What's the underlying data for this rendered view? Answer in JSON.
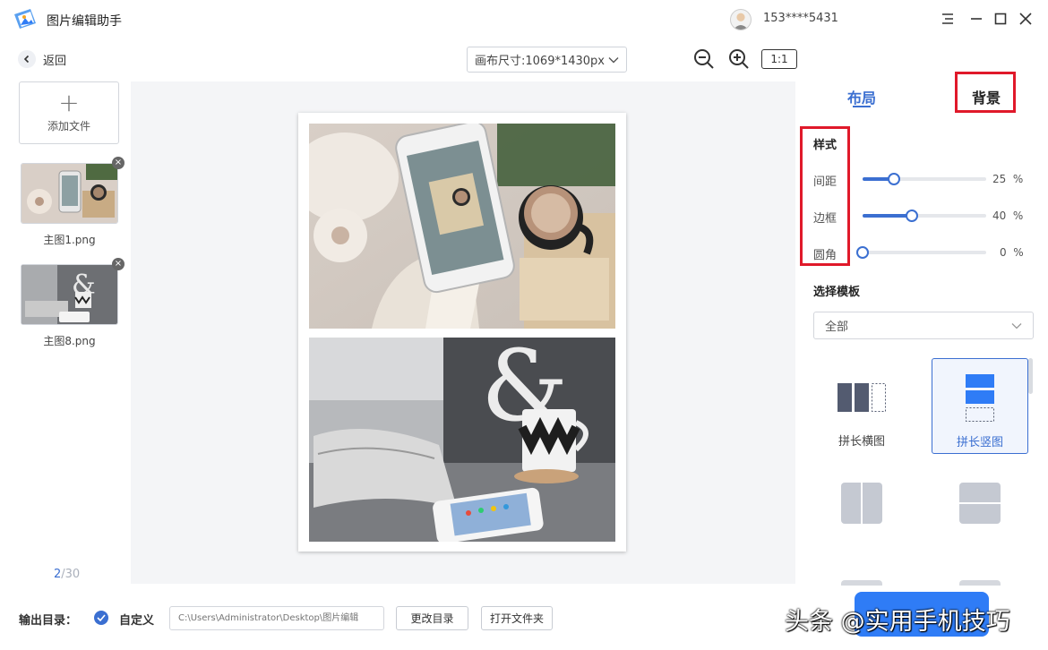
{
  "app": {
    "title": "图片编辑助手",
    "user": "153****5431"
  },
  "toolbar": {
    "back_label": "返回",
    "canvas_size": "画布尺寸:1069*1430px",
    "ratio_label": "1:1"
  },
  "files": {
    "add_label": "添加文件",
    "items": [
      {
        "name": "主图1.png"
      },
      {
        "name": "主图8.png"
      }
    ],
    "page_current": "2",
    "page_total": "/30"
  },
  "panel": {
    "tabs": [
      {
        "label": "布局",
        "active": true
      },
      {
        "label": "背景",
        "active": false
      }
    ],
    "style_title": "样式",
    "sliders": [
      {
        "label": "间距",
        "value": "25",
        "unit": "%",
        "level": 0.25
      },
      {
        "label": "边框",
        "value": "40",
        "unit": "%",
        "level": 0.4
      },
      {
        "label": "圆角",
        "value": "0",
        "unit": "%",
        "level": 0.0
      }
    ],
    "template_title": "选择模板",
    "template_filter": "全部",
    "templates": [
      {
        "label": "拼长横图",
        "selected": false
      },
      {
        "label": "拼长竖图",
        "selected": true
      }
    ]
  },
  "bottom": {
    "output_label": "输出目录：",
    "custom_label": "自定义",
    "path_placeholder": "C:\\Users\\Administrator\\Desktop\\图片编辑",
    "change_dir_label": "更改目录",
    "open_folder_label": "打开文件夹"
  },
  "watermark": "头条 @实用手机技巧",
  "colors": {
    "accent": "#3b6fd1",
    "highlight": "#e0192a",
    "primary_button": "#2f7cf6"
  }
}
